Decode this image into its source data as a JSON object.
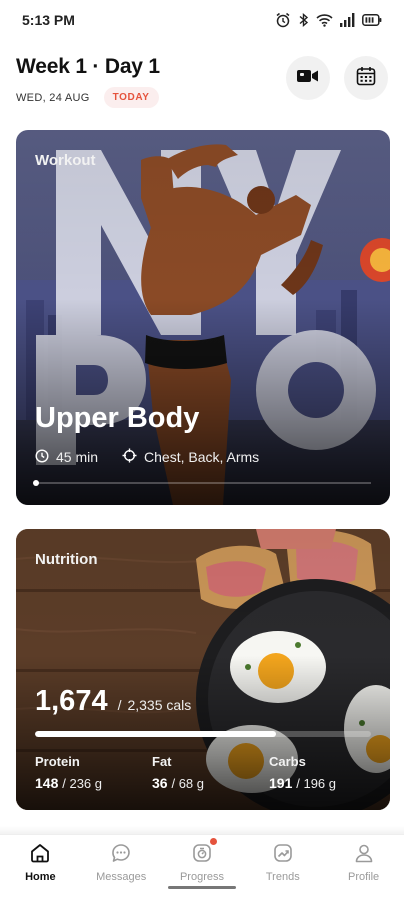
{
  "status_bar": {
    "time": "5:13 PM",
    "icons": [
      "alarm-icon",
      "bluetooth-icon",
      "wifi-icon",
      "signal-icon",
      "battery-icon"
    ]
  },
  "header": {
    "title": "Week 1 · Day 1",
    "date": "WED, 24 AUG",
    "badge": "TODAY",
    "buttons": [
      "video-camera-icon",
      "calendar-icon"
    ]
  },
  "workout": {
    "label": "Workout",
    "title": "Upper Body",
    "duration": "45 min",
    "muscles": "Chest, Back, Arms",
    "progress": 0,
    "background": "bodybuilder-back-double-biceps-pose"
  },
  "nutrition": {
    "label": "Nutrition",
    "calories_consumed": "1,674",
    "separator": "/",
    "calories_goal": "2,335 cals",
    "calories_fraction": 0.717,
    "background": "fried-eggs-and-bread-on-wooden-table",
    "macros": [
      {
        "name": "Protein",
        "value": "148",
        "goal": "/ 236 g"
      },
      {
        "name": "Fat",
        "value": "36",
        "goal": "/ 68 g"
      },
      {
        "name": "Carbs",
        "value": "191",
        "goal": "/ 196 g"
      }
    ]
  },
  "bottom_nav": {
    "items": [
      {
        "label": "Home",
        "icon": "home-icon",
        "active": true
      },
      {
        "label": "Messages",
        "icon": "chat-bubble-icon",
        "active": false
      },
      {
        "label": "Progress",
        "icon": "progress-icon",
        "active": false,
        "notification": true
      },
      {
        "label": "Trends",
        "icon": "trend-chart-icon",
        "active": false
      },
      {
        "label": "Profile",
        "icon": "person-icon",
        "active": false
      }
    ]
  },
  "colors": {
    "accent": "#e5533d",
    "badge_bg": "#fbeeee",
    "workout_bg": "#4a4f77",
    "nutrition_bg": "#4e3322"
  }
}
